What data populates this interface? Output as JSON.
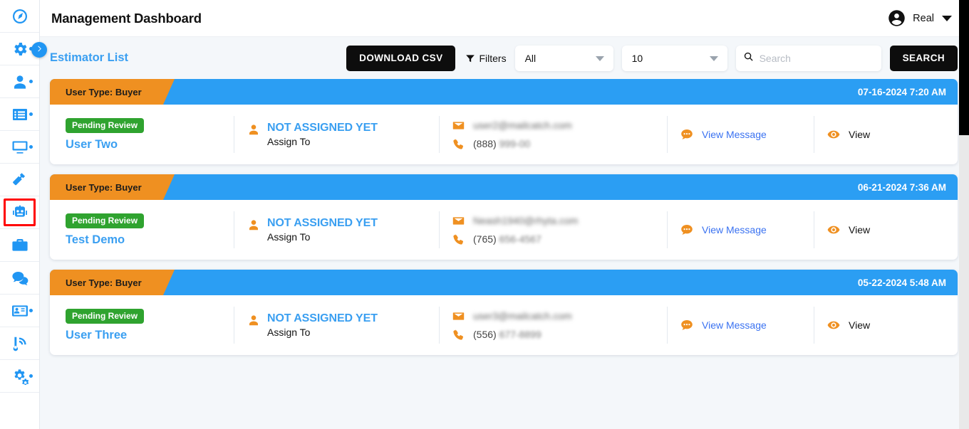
{
  "header": {
    "title": "Management Dashboard",
    "user_name": "Real",
    "avatar_icon": "account-circle-icon",
    "caret_icon": "chevron-down-icon"
  },
  "sidebar": {
    "toggle_icon": "chevron-right-icon",
    "items": [
      {
        "name": "dashboard",
        "icon": "speedometer-icon",
        "dot": false,
        "selected": false
      },
      {
        "name": "settings",
        "icon": "gear-icon",
        "dot": true,
        "selected": false
      },
      {
        "name": "users",
        "icon": "person-icon",
        "dot": true,
        "selected": false
      },
      {
        "name": "list",
        "icon": "list-box-icon",
        "dot": true,
        "selected": false
      },
      {
        "name": "monitor",
        "icon": "monitor-icon",
        "dot": true,
        "selected": false
      },
      {
        "name": "tools",
        "icon": "hammer-icon",
        "dot": false,
        "selected": false
      },
      {
        "name": "estimator",
        "icon": "robot-icon",
        "dot": false,
        "selected": true
      },
      {
        "name": "briefcase",
        "icon": "briefcase-icon",
        "dot": false,
        "selected": false
      },
      {
        "name": "messages",
        "icon": "chat-bubbles-icon",
        "dot": false,
        "selected": false
      },
      {
        "name": "contacts",
        "icon": "id-card-icon",
        "dot": true,
        "selected": false
      },
      {
        "name": "broadcast",
        "icon": "broadcast-icon",
        "dot": false,
        "selected": false
      },
      {
        "name": "config",
        "icon": "cogs-icon",
        "dot": true,
        "selected": false
      }
    ]
  },
  "toolbar": {
    "list_title": "Estimator List",
    "download_label": "DOWNLOAD CSV",
    "filters_label": "Filters",
    "filters_icon": "funnel-icon",
    "filter_select_value": "All",
    "page_size_value": "10",
    "search_placeholder": "Search",
    "search_value": "",
    "search_icon": "search-icon",
    "search_button_label": "SEARCH"
  },
  "colors": {
    "accent_blue": "#2b9ef3",
    "tag_orange": "#ef9021",
    "badge_green": "#2fa32f",
    "link_blue": "#3a9ff1",
    "highlight_red": "#ff0000"
  },
  "cards": [
    {
      "user_type_label": "User Type: Buyer",
      "date": "07-16-2024 7:20 AM",
      "status": "Pending Review",
      "name": "User Two",
      "assigned": "NOT ASSIGNED YET",
      "assign_sub": "Assign To",
      "email": "user2@mailcatch.com",
      "phone_visible": "(888)",
      "phone_masked": "999-00",
      "message_label": "View Message",
      "view_label": "View",
      "highlighted": true
    },
    {
      "user_type_label": "User Type: Buyer",
      "date": "06-21-2024 7:36 AM",
      "status": "Pending Review",
      "name": "Test Demo",
      "assigned": "NOT ASSIGNED YET",
      "assign_sub": "Assign To",
      "email": "Neash1940@rhyta.com",
      "phone_visible": "(765)",
      "phone_masked": "656-4567",
      "message_label": "View Message",
      "view_label": "View",
      "highlighted": false
    },
    {
      "user_type_label": "User Type: Buyer",
      "date": "05-22-2024 5:48 AM",
      "status": "Pending Review",
      "name": "User Three",
      "assigned": "NOT ASSIGNED YET",
      "assign_sub": "Assign To",
      "email": "user3@mailcatch.com",
      "phone_visible": "(556)",
      "phone_masked": "677-8899",
      "message_label": "View Message",
      "view_label": "View",
      "highlighted": false
    }
  ],
  "icons": {
    "envelope": "envelope-icon",
    "phone": "phone-icon",
    "person": "person-icon",
    "chat": "chat-icon",
    "eye": "eye-icon"
  }
}
